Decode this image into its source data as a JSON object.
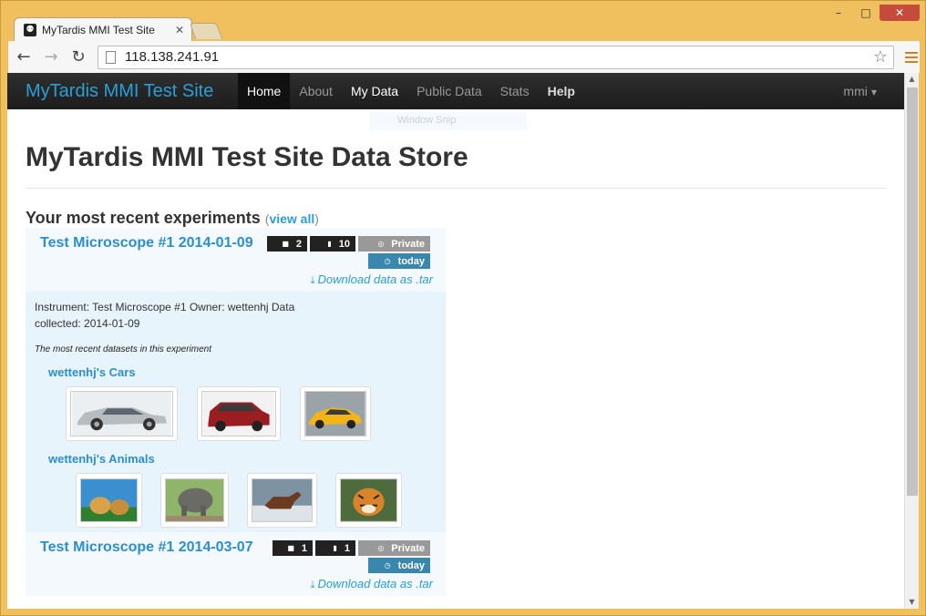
{
  "browser": {
    "tab_title": "MyTardis MMI Test Site",
    "url": "118.138.241.91"
  },
  "navbar": {
    "brand": "MyTardis MMI Test Site",
    "items": [
      "Home",
      "About",
      "My Data",
      "Public Data",
      "Stats",
      "Help"
    ],
    "user": "mmi",
    "snip_text": "Window Snip"
  },
  "page": {
    "title": "MyTardis MMI Test Site Data Store",
    "section_title": "Your most recent experiments",
    "view_all": "view all"
  },
  "experiments": [
    {
      "title": "Test Microscope #1 2014-01-09",
      "datasets_count": "2",
      "files_count": "10",
      "visibility": "Private",
      "updated": "today",
      "download": "Download data as .tar",
      "meta": "Instrument: Test Microscope #1 Owner: wettenhj Data collected: 2014-01-09",
      "recent_note": "The most recent datasets in this experiment",
      "datasets": [
        {
          "title": "wettenhj's Cars",
          "thumbs": [
            "silver-sedan",
            "red-suv",
            "yellow-sports-car"
          ]
        },
        {
          "title": "wettenhj's Animals",
          "thumbs": [
            "golden-retrievers",
            "elephant",
            "horse",
            "tiger"
          ]
        }
      ]
    },
    {
      "title": "Test Microscope #1 2014-03-07",
      "datasets_count": "1",
      "files_count": "1",
      "visibility": "Private",
      "updated": "today",
      "download": "Download data as .tar"
    }
  ]
}
